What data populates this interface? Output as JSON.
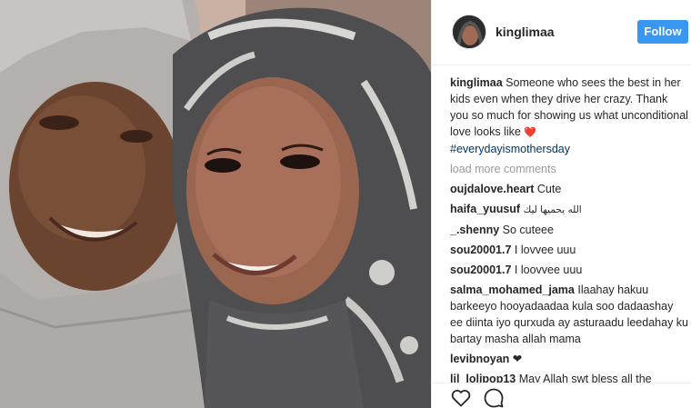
{
  "post": {
    "username": "kinglimaa",
    "follow_label": "Follow",
    "caption": {
      "username": "kinglimaa",
      "text": "Someone who sees the best in her kids even when they drive her crazy. Thank you so much for showing us what unconditional love looks like",
      "emoji": "❤️",
      "hashtag": "#everydayismothersday"
    },
    "load_more_label": "load more comments",
    "comments": [
      {
        "username": "oujdalove.heart",
        "text": "Cute"
      },
      {
        "username": "haifa_yuusuf",
        "text": "الله يحميها ليك"
      },
      {
        "username": "_.shenny",
        "text": "So cuteee"
      },
      {
        "username": "sou20001.7",
        "text": "I lovvee uuu"
      },
      {
        "username": "sou20001.7",
        "text": "I loovvee uuu"
      },
      {
        "username": "salma_mohamed_jama",
        "text": "Ilaahay hakuu barkeeyo hooyadaadaa kula soo dadaashay ee diinta iyo qurxuda ay asturaadu leedahay ku bartay masha allah mama"
      },
      {
        "username": "levibnoyan",
        "text": "❤"
      },
      {
        "username": "lil_lolipop13",
        "text": "May Allah swt bless all the"
      }
    ],
    "icons": {
      "like": "heart-icon",
      "comment": "comment-bubble-icon"
    }
  }
}
